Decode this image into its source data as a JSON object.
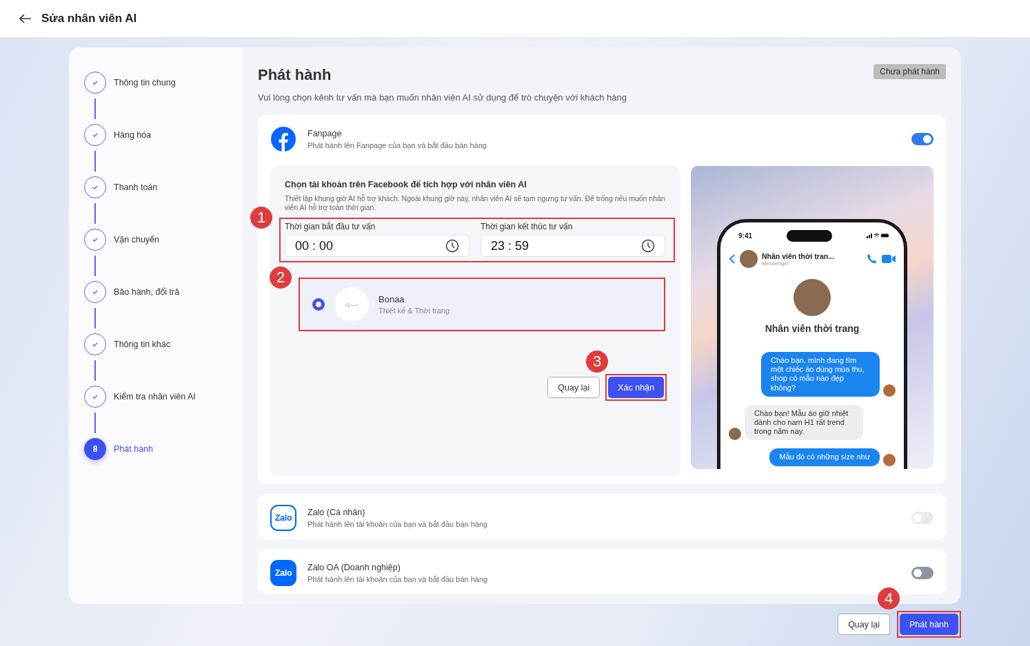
{
  "header": {
    "title": "Sửa nhân viên AI"
  },
  "steps": [
    {
      "label": "Thông tin chung",
      "done": true,
      "selected": false
    },
    {
      "label": "Hàng hóa",
      "done": true,
      "selected": false
    },
    {
      "label": "Thanh toán",
      "done": true,
      "selected": false
    },
    {
      "label": "Vận chuyển",
      "done": true,
      "selected": false
    },
    {
      "label": "Bảo hành, đổi trả",
      "done": true,
      "selected": false
    },
    {
      "label": "Thông tin khác",
      "done": true,
      "selected": false
    },
    {
      "label": "Kiểm tra nhân viên AI",
      "done": true,
      "selected": false
    },
    {
      "label": "Phát hành",
      "selected": true,
      "number": "8"
    }
  ],
  "page": {
    "title": "Phát hành",
    "subtitle": "Vui lòng chọn kênh tư vấn mà bạn muốn nhân viên AI sử dụng để trò chuyện với khách hàng",
    "status_badge": "Chưa phát hành"
  },
  "channels": [
    {
      "kind": "facebook",
      "name": "Fanpage",
      "description": "Phát hành lên Fanpage của bạn và bắt đầu bán hàng",
      "on": true,
      "disabled": false,
      "settings": {
        "title": "Chọn tài khoản trên Facebook để tích hợp với nhân viên AI",
        "hint": "Thiết lập khung giờ AI hỗ trợ khách. Ngoài khung giờ này, nhân viên AI sẽ tạm ngưng tư vấn. Để trống nếu muốn nhân viên AI hỗ trợ toàn thời gian.",
        "time_marker": "1",
        "times": [
          {
            "label": "Thời gian bắt đầu tư vấn",
            "value": "00 : 00"
          },
          {
            "label": "Thời gian kết thúc tư vấn",
            "value": "23 : 59"
          }
        ],
        "account_marker": "2",
        "accounts": [
          {
            "name": "Bonaa",
            "category": "Thiết kế & Thời trang",
            "selected": true
          }
        ],
        "buttons": [
          {
            "label": "Quay lại",
            "kind": "secondary"
          },
          {
            "label": "Xác nhận",
            "kind": "primary",
            "marker": "3"
          }
        ]
      },
      "preview": {
        "clock": "9:41",
        "contact": "Nhân viên thời tran...",
        "app": "Messenger",
        "profile_name": "Nhân viên thời trang",
        "messages": [
          {
            "kind": "outgoing",
            "text": "Chào bạn, mình đang tìm một chiếc áo dùng mùa thu, shop có mẫu nào đẹp không?"
          },
          {
            "kind": "incoming",
            "text": "Chào bạn! Mẫu áo giữ nhiệt dành cho nam H1 rất trend trong năm nay."
          },
          {
            "kind": "outgoing",
            "text": "Mẫu đó có những size như"
          }
        ]
      }
    },
    {
      "kind": "zalo",
      "logo_text": "Zalo",
      "name": "Zalo (Cá nhân)",
      "description": "Phát hành lên tài khoản của bạn và bắt đầu bán hàng",
      "on": false,
      "disabled": true
    },
    {
      "kind": "zalo_oa",
      "logo_text": "Zalo",
      "name": "Zalo OA (Doanh nghiệp)",
      "description": "Phát hành lên tài khoản của bạn và bắt đầu bán hàng",
      "on": false,
      "disabled": false
    }
  ],
  "footer": {
    "buttons": [
      {
        "label": "Quay lại",
        "kind": "secondary"
      },
      {
        "label": "Phát hành",
        "kind": "primary",
        "marker": "4"
      }
    ]
  }
}
